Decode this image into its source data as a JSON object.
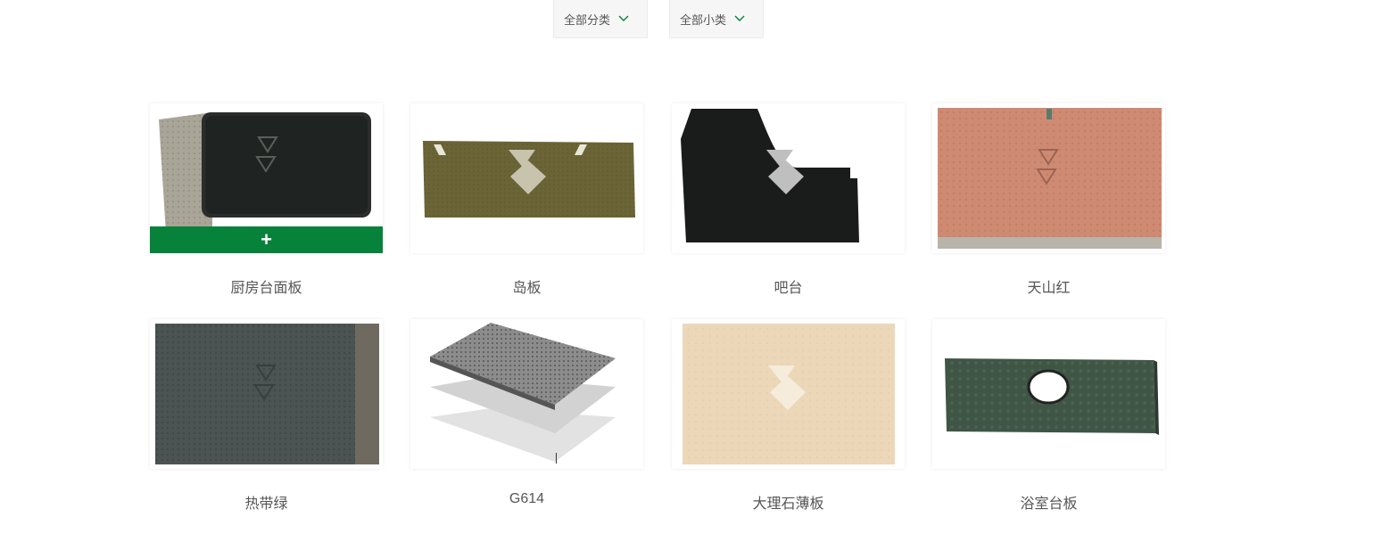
{
  "filters": {
    "category": {
      "label": "全部分类",
      "icon": "chevron-down-icon"
    },
    "subcategory": {
      "label": "全部小类",
      "icon": "chevron-down-icon"
    }
  },
  "accent_color": "#06823a",
  "products": [
    {
      "name": "厨房台面板",
      "hovered": true,
      "add_label": "+"
    },
    {
      "name": "岛板"
    },
    {
      "name": "吧台"
    },
    {
      "name": "天山红"
    },
    {
      "name": "热带绿"
    },
    {
      "name": "G614"
    },
    {
      "name": "大理石薄板"
    },
    {
      "name": "浴室台板"
    }
  ]
}
